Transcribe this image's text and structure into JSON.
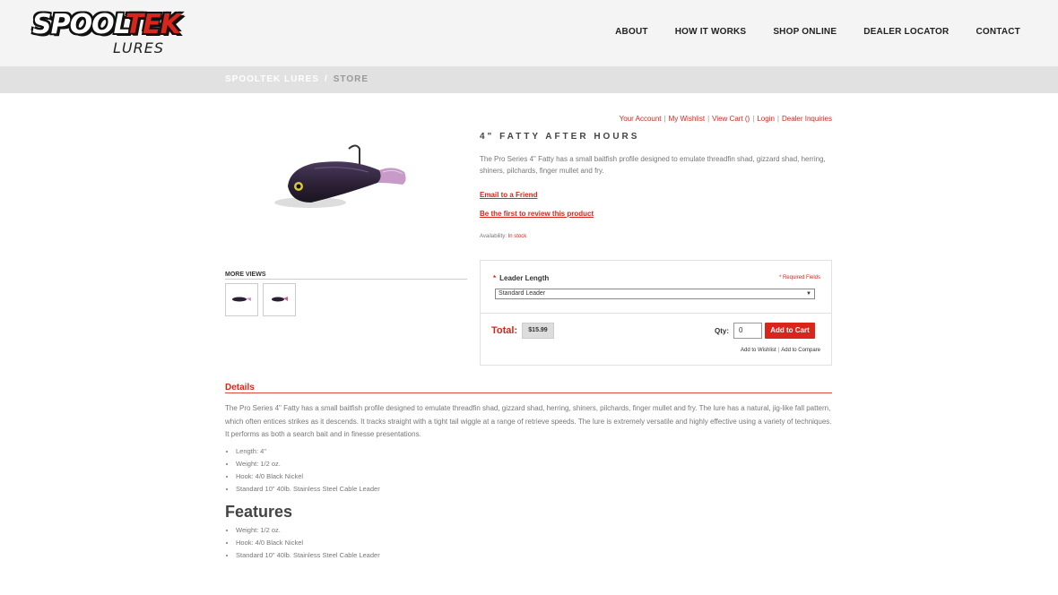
{
  "brand": {
    "logo_main_a": "SPOOL",
    "logo_main_b": "TEK",
    "logo_sub": "LURES"
  },
  "nav": {
    "items": [
      "ABOUT",
      "HOW IT WORKS",
      "SHOP ONLINE",
      "DEALER LOCATOR",
      "CONTACT"
    ]
  },
  "breadcrumb": {
    "home": "SPOOLTEK LURES",
    "separator": "/",
    "current": "STORE"
  },
  "account_links": [
    "Your Account",
    "My Wishlist",
    "View Cart ()",
    "Login",
    "Dealer Inquiries"
  ],
  "product": {
    "title": "4\" FATTY AFTER HOURS",
    "short_description": "The Pro Series 4\" Fatty has a small baitfish profile designed to emulate threadfin shad, gizzard shad, herring, shiners, pilchards, finger mullet and fry.",
    "email_friend": "Email to a Friend",
    "review": "Be the first to review this product",
    "availability_label": "Availability:",
    "availability_value": "In stock",
    "more_views": "MORE VIEWS"
  },
  "options": {
    "label": "Leader Length",
    "required_marker": "*",
    "required_note": "* Required Fields",
    "selected": "Standard Leader",
    "total_label": "Total:",
    "total_price": "$15.99",
    "qty_label": "Qty:",
    "qty_value": "0",
    "add_to_cart": "Add to Cart",
    "add_to_wishlist": "Add to Wishlist",
    "add_to_compare": "Add to Compare"
  },
  "details": {
    "heading": "Details",
    "text": "The Pro Series 4\" Fatty has a small baitfish profile designed to emulate threadfin shad, gizzard shad, herring, shiners, pilchards, finger mullet and fry. The lure has a natural, jig-like fall pattern, which often entices strikes as it descends. It tracks straight with a tight tail wiggle at a range of retrieve speeds. The lure is extremely versatile and highly effective using a variety of techniques. It performs as both a search bait and in finesse presentations.",
    "specs": [
      "Length: 4\"",
      "Weight: 1/2 oz.",
      "Hook: 4/0 Black Nickel",
      "Standard 10\" 40lb. Stainless Steel Cable Leader"
    ]
  },
  "features": {
    "heading": "Features",
    "items": [
      "Weight: 1/2 oz.",
      "Hook: 4/0 Black Nickel",
      "Standard 10\" 40lb. Stainless Steel Cable Leader"
    ]
  },
  "colors": {
    "accent": "#d9261c",
    "header_bg": "#f4f4f4",
    "crumb_bg": "#e1e1e1"
  },
  "icons": {
    "select_arrow": "chevron-down-icon"
  }
}
